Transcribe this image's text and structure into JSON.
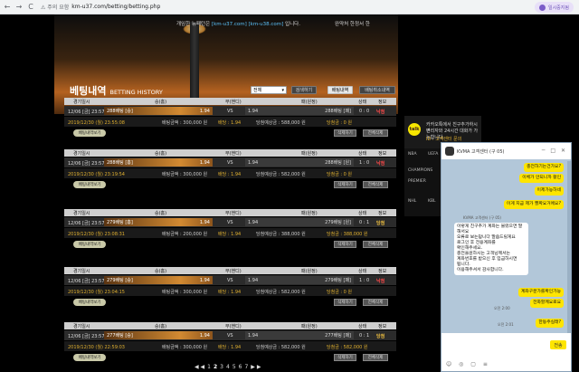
{
  "browser": {
    "back": "←",
    "forward": "→",
    "reload": "C",
    "security": "⚠ 주의 요함",
    "url": "km-u37.com/betting/betting.php",
    "profile": "일시중지됨"
  },
  "site": {
    "notice_prefix": "개임한 뉴패턴은",
    "domain1": "[km-u37.com]",
    "domain2": "[km-u38.com]",
    "notice_suffix": "입니다.",
    "top_link": "완약처 한정서 한",
    "title_ko": "베팅내역",
    "title_en": "BETTING HISTORY",
    "select_value": "전체",
    "search_btn": "검색하기",
    "bet_btn": "배팅내역",
    "cancel_btn": "배팅취소내역"
  },
  "headers": {
    "time": "경기일시",
    "home": "승(홈)",
    "draw": "무(핸디)",
    "away": "패(원정)",
    "status": "상태",
    "info": "정보"
  },
  "bets": [
    {
      "date": "12/06 [금] 23:57",
      "home": "288배팅 [승]",
      "home_odds": "1.94",
      "draw": "VS",
      "away_odds": "1.94",
      "away": "288배팅 [패]",
      "score": "0 : 0",
      "status": "낙첨",
      "bet_time": "2019/12/30 (월) 23:55:08",
      "amount": "배팅금액 : 300,000 원",
      "odds": "배당 : 1.94",
      "expected": "당첨예상금 : 588,000 원",
      "win": "당첨금 : 0 원"
    },
    {
      "date": "12/06 [금] 23:57",
      "home": "288배팅 [홈]",
      "home_odds": "1.94",
      "draw": "VS",
      "away_odds": "1.94",
      "away": "288배팅 [원]",
      "score": "1 : 0",
      "status": "낙첨",
      "bet_time": "2019/12/30 (월) 23:19:54",
      "amount": "배팅금액 : 300,000 원",
      "odds": "배당 : 1.94",
      "expected": "당첨예상금 : 582,000 원",
      "win": "당첨금 : 0 원"
    },
    {
      "date": "12/06 [금] 23:57",
      "home": "279배팅 [홈]",
      "home_odds": "1.94",
      "draw": "VS",
      "away_odds": "1.94",
      "away": "279배팅 [원]",
      "score": "0 : 1",
      "status": "당첨",
      "bet_time": "2019/12/30 (월) 23:08:31",
      "amount": "배팅금액 : 200,000 원",
      "odds": "배당 : 1.94",
      "expected": "당첨예상금 : 388,000 원",
      "win": "당첨금 : 388,000 원"
    },
    {
      "date": "12/06 [금] 23:57",
      "home": "279배팅 [승]",
      "home_odds": "1.94",
      "draw": "VS",
      "away_odds": "1.94",
      "away": "279배팅 [패]",
      "score": "1 : 0",
      "status": "낙첨",
      "bet_time": "2019/12/30 (월) 23:04:15",
      "amount": "배팅금액 : 300,000 원",
      "odds": "배당 : 1.94",
      "expected": "당첨예상금 : 582,000 원",
      "win": "당첨금 : 0 원"
    },
    {
      "date": "12/06 [금] 23:57",
      "home": "277배팅 [승]",
      "home_odds": "1.94",
      "draw": "VS",
      "away_odds": "1.94",
      "away": "277배팅 [패]",
      "score": "0 : 1",
      "status": "당첨",
      "bet_time": "2019/12/30 (월) 22:59:03",
      "amount": "배팅금액 : 300,000 원",
      "odds": "배당 : 1.94",
      "expected": "당첨예상금 : 582,000 원",
      "win": "당첨금 : 582,000 원"
    }
  ],
  "row_buttons": {
    "detail": "배팅내역보기",
    "del": "삭제하기",
    "delall": "전체삭제"
  },
  "pagination": {
    "prev": "◀ ◀",
    "pages": [
      "1",
      "2",
      "3",
      "4",
      "5",
      "6",
      "7"
    ],
    "next": "▶ ▶"
  },
  "kakao": {
    "badge": "talk",
    "line1": "카카오톡에서 친구추가하시면",
    "line2": "관리자와 24시간 대화가 가능합니다.",
    "line3": "ID : 고객센터 문의"
  },
  "partners": [
    "NBA",
    "UEFA",
    "CHAMPIONS",
    "PREMIER",
    "NHL",
    "KBL"
  ],
  "chat": {
    "title": "KVMA 고객센터 (구 05)",
    "controls": "─ □ ✕",
    "msg1": "충전하기는건가요?",
    "msg2": "이체가 안되니까 활인",
    "msg3": "이제가능하네",
    "msg4": "이게 지금 제가 짤짜요거에요?",
    "agent_name": "KVMA 고객센터 (구 05)",
    "msg5_lines": [
      "이렇게 친구추가 계좌는 불렀으면 말해서요",
      "오류로 보는답니다 말씀드릴게요",
      "로그인 후 전용계좌를",
      "확인해주세요.",
      "충전을원하시는 고객님께서는",
      "계좌번호를 받으신 후 입금하시면",
      "됩니다.",
      "이용해주셔서 감사합니다."
    ],
    "msg6": "계좌구분가를확인가능",
    "msg7": "전화할께요로요",
    "time1": "오전 2:00",
    "msg8": "한동주실래?",
    "time2": "오전 2:01",
    "send": "전송",
    "input_icons": "☺ ◎ ▢ ≡"
  }
}
